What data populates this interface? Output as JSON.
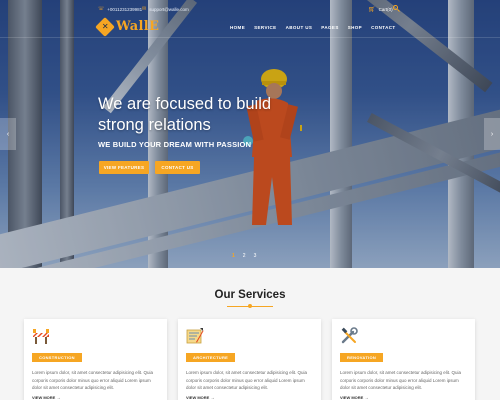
{
  "header": {
    "logo_text": "WallE",
    "logo_glyph": "✕",
    "phone": "+0011231239981",
    "email": "support@walle.com",
    "cart_label": "Cart(0)",
    "nav": [
      "HOME",
      "SERVICE",
      "ABOUT US",
      "PAGES",
      "SHOP",
      "CONTACT"
    ]
  },
  "hero": {
    "headline": "We are focused to build strong relations",
    "subline": "WE BUILD YOUR DREAM WITH PASSION",
    "btn_primary": "VIEW FEATURES",
    "btn_secondary": "CONTACT US",
    "prev_arrow": "‹",
    "next_arrow": "›",
    "dots": [
      "1",
      "2",
      "3"
    ]
  },
  "services": {
    "title": "Our Services",
    "cards": [
      {
        "icon": "barrier-icon",
        "badge": "CONSTRUCTION",
        "text": "Lorem ipsum dolor, sit amet consectetur adipisicing elit. Quia corporis corporis dolor minus quo error aliquid Lorem ipsum dolor sit amet consectetur adipisicing elit.",
        "link": "VIEW MORE →"
      },
      {
        "icon": "blueprint-icon",
        "badge": "ARCHITECTURE",
        "text": "Lorem ipsum dolor, sit amet consectetur adipisicing elit. Quia corporis corporis dolor minus quo error aliquid Lorem ipsum dolor sit amet consectetur adipisicing elit.",
        "link": "VIEW MORE →"
      },
      {
        "icon": "tools-icon",
        "badge": "RENOVATION",
        "text": "Lorem ipsum dolor, sit amet consectetur adipisicing elit. Quia corporis corporis dolor minus quo error aliquid Lorem ipsum dolor sit amet consectetur adipisicing elit.",
        "link": "VIEW MORE →"
      }
    ]
  },
  "colors": {
    "accent": "#f6a623",
    "hero_sky": "#2a4a8a",
    "page_bg": "#f5f5f5"
  }
}
